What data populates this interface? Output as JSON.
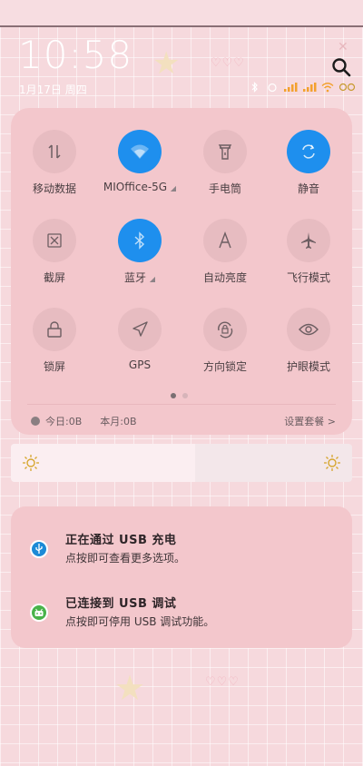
{
  "status": {
    "time": "10:58",
    "date": "1月17日 周四"
  },
  "quick_settings": {
    "tiles": [
      {
        "label": "移动数据",
        "icon": "mobile-data-icon",
        "active": false
      },
      {
        "label": "MIOffice-5G",
        "icon": "wifi-icon",
        "active": true,
        "has_dropdown": true
      },
      {
        "label": "手电筒",
        "icon": "flashlight-icon",
        "active": false
      },
      {
        "label": "静音",
        "icon": "mute-icon",
        "active": true
      },
      {
        "label": "截屏",
        "icon": "screenshot-icon",
        "active": false
      },
      {
        "label": "蓝牙",
        "icon": "bluetooth-icon",
        "active": true,
        "has_dropdown": true
      },
      {
        "label": "自动亮度",
        "icon": "auto-brightness-icon",
        "active": false
      },
      {
        "label": "飞行模式",
        "icon": "airplane-icon",
        "active": false
      },
      {
        "label": "锁屏",
        "icon": "lock-icon",
        "active": false
      },
      {
        "label": "GPS",
        "icon": "gps-icon",
        "active": false
      },
      {
        "label": "方向锁定",
        "icon": "rotation-lock-icon",
        "active": false
      },
      {
        "label": "护眼模式",
        "icon": "eye-icon",
        "active": false
      }
    ],
    "page_dots": {
      "count": 2,
      "current": 1
    },
    "usage_today": "今日:0B",
    "usage_month": "本月:0B",
    "settings_link": "设置套餐 >"
  },
  "brightness": {
    "level_percent": 54
  },
  "notifications": [
    {
      "title": "正在通过 USB 充电",
      "subtitle": "点按即可查看更多选项。",
      "icon": "usb-icon"
    },
    {
      "title": "已连接到 USB 调试",
      "subtitle": "点按即可停用 USB 调试功能。",
      "icon": "android-debug-icon"
    }
  ],
  "colors": {
    "active_tile": "#1e8fee",
    "panel": "#f3c7cc",
    "background": "#f6d9dd"
  }
}
